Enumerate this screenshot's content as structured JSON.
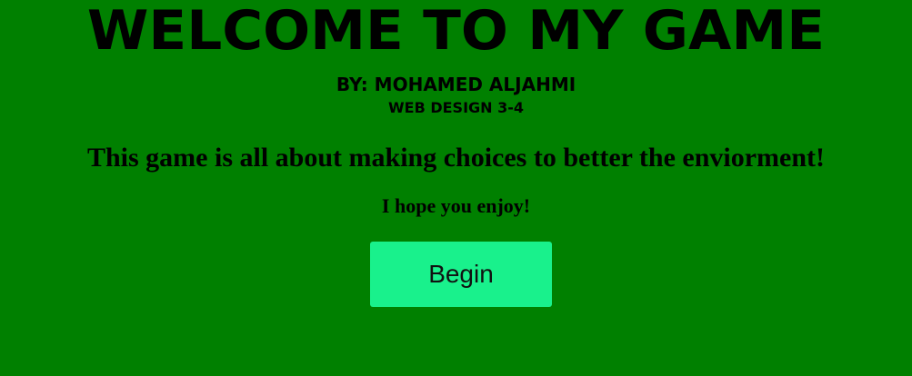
{
  "header": {
    "title": "WELCOME TO MY GAME",
    "byline": "BY: MOHAMED ALJAHMI",
    "course": "WEB DESIGN 3-4"
  },
  "intro": {
    "lead": "This game is all about making choices to better the enviorment!",
    "enjoy": "I hope you enjoy!"
  },
  "actions": {
    "begin_label": "Begin"
  },
  "colors": {
    "background": "#008000",
    "button": "#19f18c",
    "text": "#000000"
  }
}
